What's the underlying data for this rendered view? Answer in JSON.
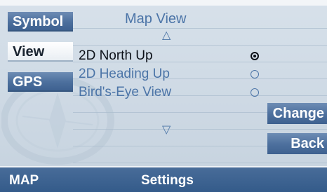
{
  "side_menu": [
    {
      "label": "Symbol",
      "active": false
    },
    {
      "label": "View",
      "active": true
    },
    {
      "label": "GPS",
      "active": false
    }
  ],
  "title": "Map View",
  "scroll": {
    "up_glyph": "△",
    "down_glyph": "▽"
  },
  "options": [
    {
      "label": "2D North Up",
      "selected": true
    },
    {
      "label": "2D Heading Up",
      "selected": false
    },
    {
      "label": "Bird's-Eye View",
      "selected": false
    }
  ],
  "buttons": {
    "change": "Change",
    "back": "Back"
  },
  "footer": {
    "left": "MAP",
    "center": "Settings"
  },
  "colors": {
    "accent": "#4b74a7",
    "button": "#4c6f9d",
    "footer": "#3d6291",
    "background": "#d3dde7"
  }
}
